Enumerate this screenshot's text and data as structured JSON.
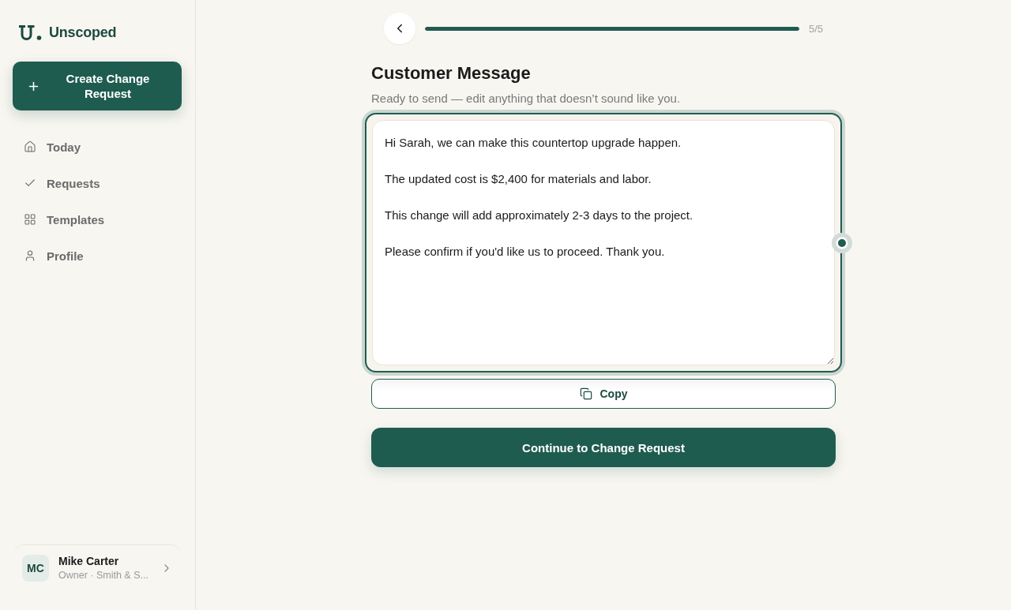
{
  "sidebar": {
    "brand": "Unscoped",
    "create_button": {
      "label": "Create Change Request"
    },
    "nav_items": [
      {
        "label": "Today",
        "selected": false
      },
      {
        "label": "Requests",
        "selected": false
      },
      {
        "label": "Templates",
        "selected": false
      },
      {
        "label": "Profile",
        "selected": false
      }
    ],
    "user": {
      "initials": "MC",
      "name": "Mike Carter",
      "role": "Owner · Smith & S..."
    }
  },
  "progress": {
    "level": 1,
    "counter": "5/5"
  },
  "main": {
    "title": "Customer Message",
    "subtitle": "Ready to send — edit anything that doesn’t sound like you.",
    "message": {
      "value": "Hi Sarah, we can make this countertop upgrade happen.\n\nThe updated cost is $2,400 for materials and labor.\n\nThis change will add approximately 2-3 days to the project.\n\nPlease confirm if you'd like us to proceed. Thank you."
    },
    "copy_button": {
      "label": "Copy"
    },
    "continue_button": {
      "label": "Continue to Change Request"
    }
  }
}
